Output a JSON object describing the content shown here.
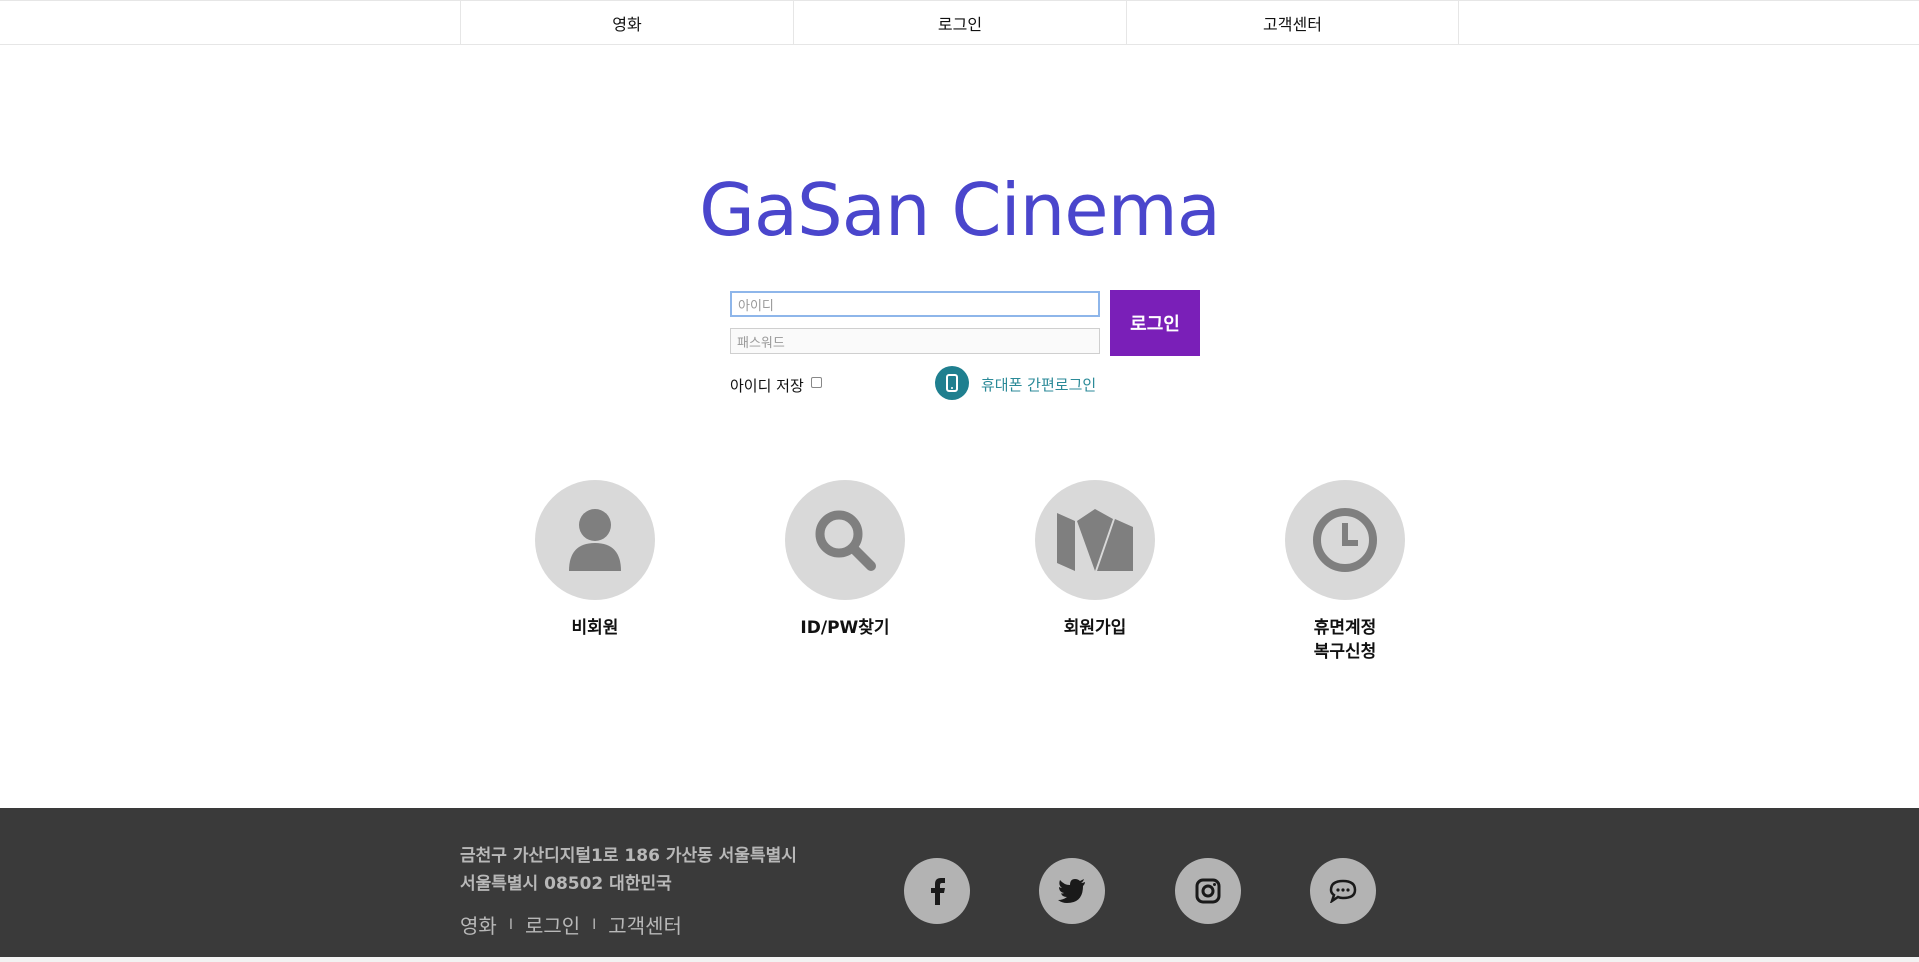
{
  "nav": {
    "items": [
      {
        "label": "영화"
      },
      {
        "label": "로그인"
      },
      {
        "label": "고객센터"
      }
    ]
  },
  "logo": {
    "text": "GaSan Cinema",
    "color": "#4a46cc"
  },
  "login": {
    "id_placeholder": "아이디",
    "password_placeholder": "패스워드",
    "button_label": "로그인",
    "button_color": "#7a1fb8",
    "save_id_label": "아이디 저장",
    "phone_login_label": "휴대폰 간편로그인"
  },
  "menu": {
    "items": [
      {
        "label": "비회원",
        "icon": "person-icon"
      },
      {
        "label": "ID/PW찾기",
        "icon": "search-icon"
      },
      {
        "label": "회원가입",
        "icon": "medium-m-icon"
      },
      {
        "label": "휴면계정\n복구신청",
        "icon": "clock-icon"
      }
    ]
  },
  "footer": {
    "address_line1": "금천구 가산디지털1로 186 가산동 서울특별시",
    "address_line2": "서울특별시 08502 대한민국",
    "links": [
      "영화",
      "로그인",
      "고객센터"
    ],
    "separator": "I",
    "social": [
      "facebook-icon",
      "twitter-icon",
      "instagram-icon",
      "chat-icon"
    ]
  }
}
